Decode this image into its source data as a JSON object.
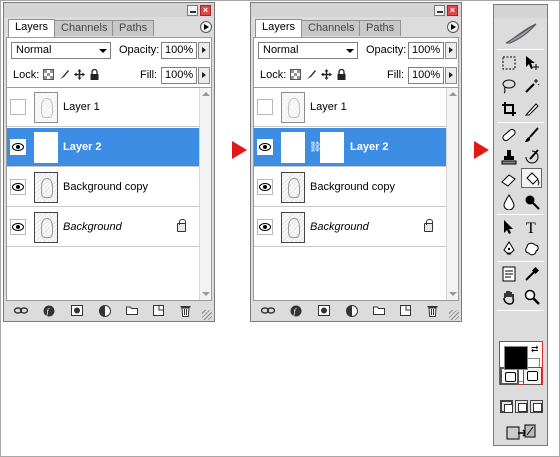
{
  "panels": [
    {
      "tabs": [
        "Layers",
        "Channels",
        "Paths"
      ],
      "blend_mode": "Normal",
      "opacity_label": "Opacity:",
      "opacity_value": "100%",
      "lock_label": "Lock:",
      "fill_label": "Fill:",
      "fill_value": "100%",
      "layers": [
        {
          "name": "Layer 1",
          "visible": false,
          "selected": false,
          "italic": false,
          "locked": false
        },
        {
          "name": "Layer 2",
          "visible": true,
          "selected": true,
          "italic": false,
          "locked": false,
          "mask": false
        },
        {
          "name": "Background copy",
          "visible": true,
          "selected": false,
          "italic": false,
          "locked": false
        },
        {
          "name": "Background",
          "visible": true,
          "selected": false,
          "italic": true,
          "locked": true
        }
      ]
    },
    {
      "tabs": [
        "Layers",
        "Channels",
        "Paths"
      ],
      "blend_mode": "Normal",
      "opacity_label": "Opacity:",
      "opacity_value": "100%",
      "lock_label": "Lock:",
      "fill_label": "Fill:",
      "fill_value": "100%",
      "layers": [
        {
          "name": "Layer 1",
          "visible": false,
          "selected": false,
          "italic": false,
          "locked": false
        },
        {
          "name": "Layer 2",
          "visible": true,
          "selected": true,
          "italic": false,
          "locked": false,
          "mask": true
        },
        {
          "name": "Background copy",
          "visible": true,
          "selected": false,
          "italic": false,
          "locked": false
        },
        {
          "name": "Background",
          "visible": true,
          "selected": false,
          "italic": true,
          "locked": true
        }
      ]
    }
  ],
  "toolbox": {
    "foreground_color": "#000000",
    "background_color": "#ffffff"
  },
  "colors": {
    "selection": "#3d8de4",
    "arrow": "#e01818"
  }
}
